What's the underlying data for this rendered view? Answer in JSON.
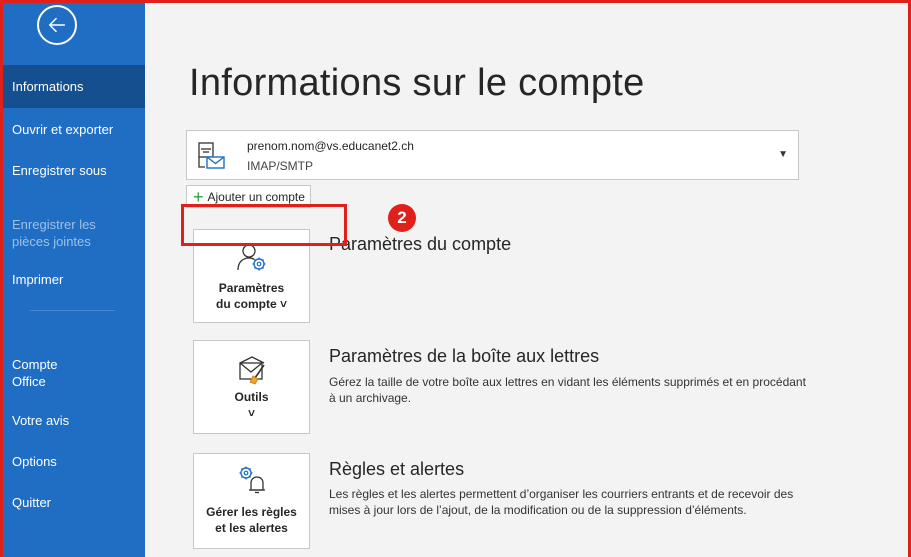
{
  "sidebar": {
    "items": [
      {
        "label": "Informations",
        "state": "active"
      },
      {
        "label": "Ouvrir et exporter",
        "state": "normal"
      },
      {
        "label": "Enregistrer sous",
        "state": "normal"
      },
      {
        "label": "Enregistrer les\npièces jointes",
        "state": "disabled"
      },
      {
        "label": "Imprimer",
        "state": "normal"
      },
      {
        "label": "Compte\nOffice",
        "state": "normal"
      },
      {
        "label": "Votre avis",
        "state": "normal"
      },
      {
        "label": "Options",
        "state": "normal"
      },
      {
        "label": "Quitter",
        "state": "normal"
      }
    ]
  },
  "page": {
    "title": "Informations sur le compte"
  },
  "account": {
    "email": "prenom.nom@vs.educanet2.ch",
    "type": "IMAP/SMTP"
  },
  "add_account_label": "Ajouter un compte",
  "annotation": {
    "step": "2"
  },
  "sections": [
    {
      "card_label": "Paramètres\ndu compte ˅",
      "title": "Paramètres du compte",
      "description": ""
    },
    {
      "card_label": "Outils\n˅",
      "title": "Paramètres de la boîte aux lettres",
      "description": "Gérez la taille de votre boîte aux lettres en vidant les éléments supprimés et en procédant à un archivage."
    },
    {
      "card_label": "Gérer les règles\net les alertes",
      "title": "Règles et alertes",
      "description": "Les règles et les alertes permettent d’organiser les courriers entrants et de recevoir des mises à jour lors de l’ajout, de la modification ou de la suppression d’éléments."
    }
  ],
  "colors": {
    "sidebar": "#1f6ec3",
    "sidebar_active": "#154f8f",
    "annotation_red": "#e0201b",
    "accent_orange": "#f4a21f"
  }
}
